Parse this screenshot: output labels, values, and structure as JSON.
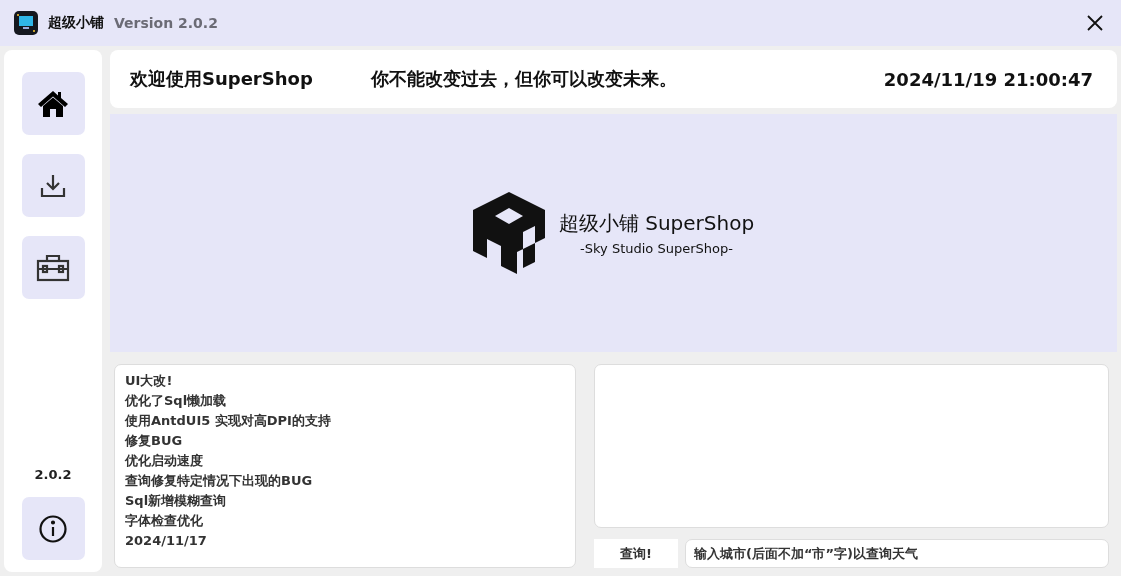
{
  "window": {
    "title": "超级小铺",
    "version": "Version 2.0.2"
  },
  "sidebar": {
    "items": [
      {
        "kind": "home"
      },
      {
        "kind": "download"
      },
      {
        "kind": "toolbox"
      }
    ],
    "version": "2.0.2",
    "info": {
      "kind": "info"
    }
  },
  "header": {
    "welcome": "欢迎使用SuperShop",
    "motto": "你不能改变过去，但你可以改变未来。",
    "datetime": "2024/11/19 21:00:47"
  },
  "banner": {
    "title": "超级小铺 SuperShop",
    "subtitle": "-Sky Studio SuperShop-"
  },
  "changelog": [
    "UI大改!",
    "优化了Sql懒加载",
    "使用AntdUI5 实现对高DPI的支持",
    "修复BUG",
    "优化启动速度",
    "查询修复特定情况下出现的BUG",
    "Sql新增模糊查询",
    "字体检查优化",
    "2024/11/17"
  ],
  "weather": {
    "button": "查询!",
    "placeholder": "输入城市(后面不加“市”字)以查询天气"
  }
}
